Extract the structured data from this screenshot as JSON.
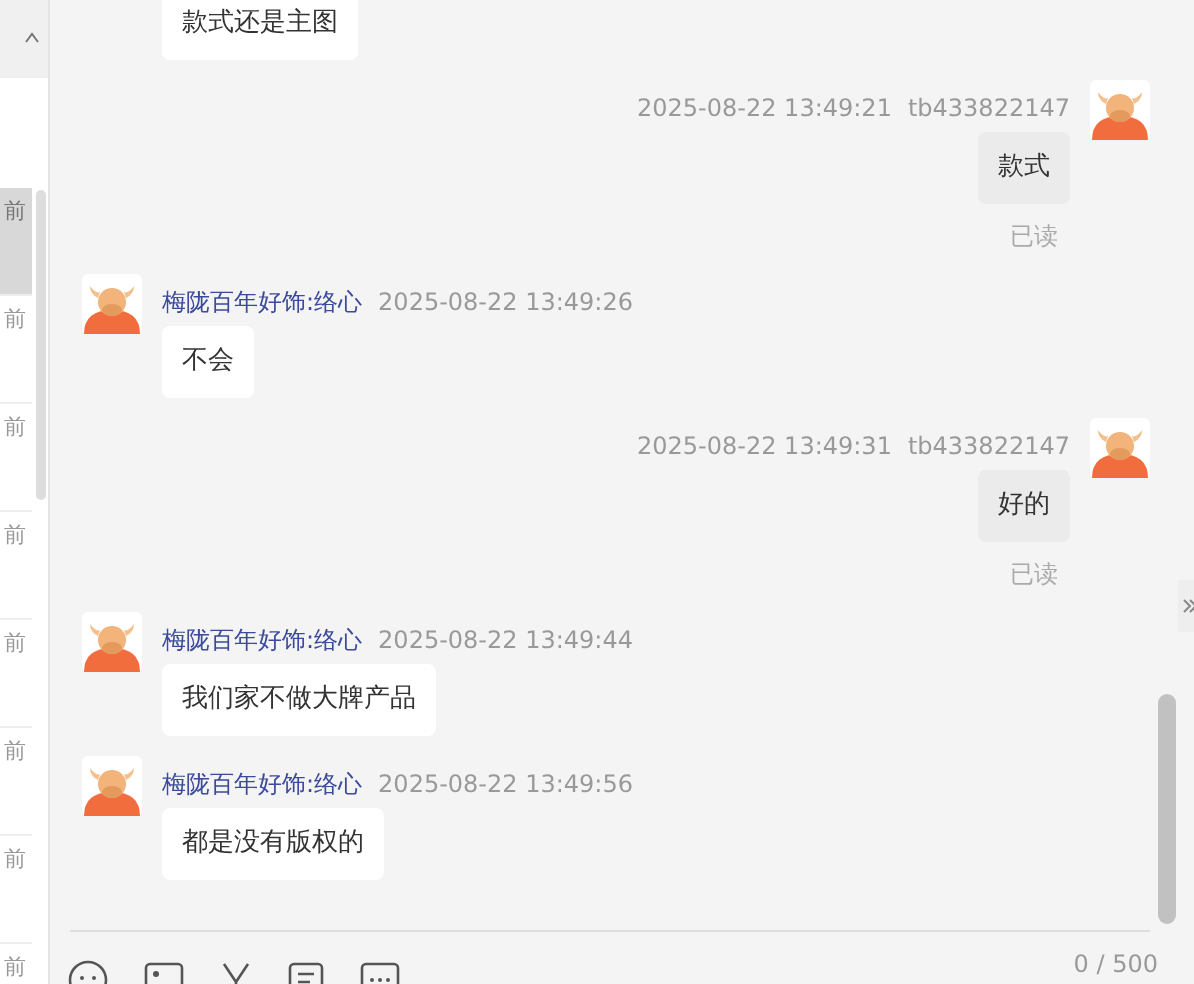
{
  "sidebar": {
    "items": [
      {
        "time": "前",
        "selected": true
      },
      {
        "time": "前",
        "selected": false
      },
      {
        "time": "前",
        "selected": false
      },
      {
        "time": "前",
        "selected": false
      },
      {
        "time": "前",
        "selected": false
      },
      {
        "time": "前",
        "selected": false
      },
      {
        "time": "前",
        "selected": false
      },
      {
        "time": "前",
        "selected": false
      }
    ]
  },
  "messages": [
    {
      "kind": "incoming",
      "text": "款式还是主图"
    },
    {
      "kind": "outgoing",
      "time": "2025-08-22 13:49:21",
      "sender": "tb433822147",
      "text": "款式",
      "read_status": "已读"
    },
    {
      "kind": "incoming",
      "sender": "梅陇百年好饰:络心",
      "time": "2025-08-22 13:49:26",
      "text": "不会"
    },
    {
      "kind": "outgoing",
      "time": "2025-08-22 13:49:31",
      "sender": "tb433822147",
      "text": "好的",
      "read_status": "已读"
    },
    {
      "kind": "incoming",
      "sender": "梅陇百年好饰:络心",
      "time": "2025-08-22 13:49:44",
      "text": "我们家不做大牌产品"
    },
    {
      "kind": "incoming",
      "sender": "梅陇百年好饰:络心",
      "time": "2025-08-22 13:49:56",
      "text": "都是没有版权的"
    }
  ],
  "composer": {
    "counter": "0 / 500"
  }
}
